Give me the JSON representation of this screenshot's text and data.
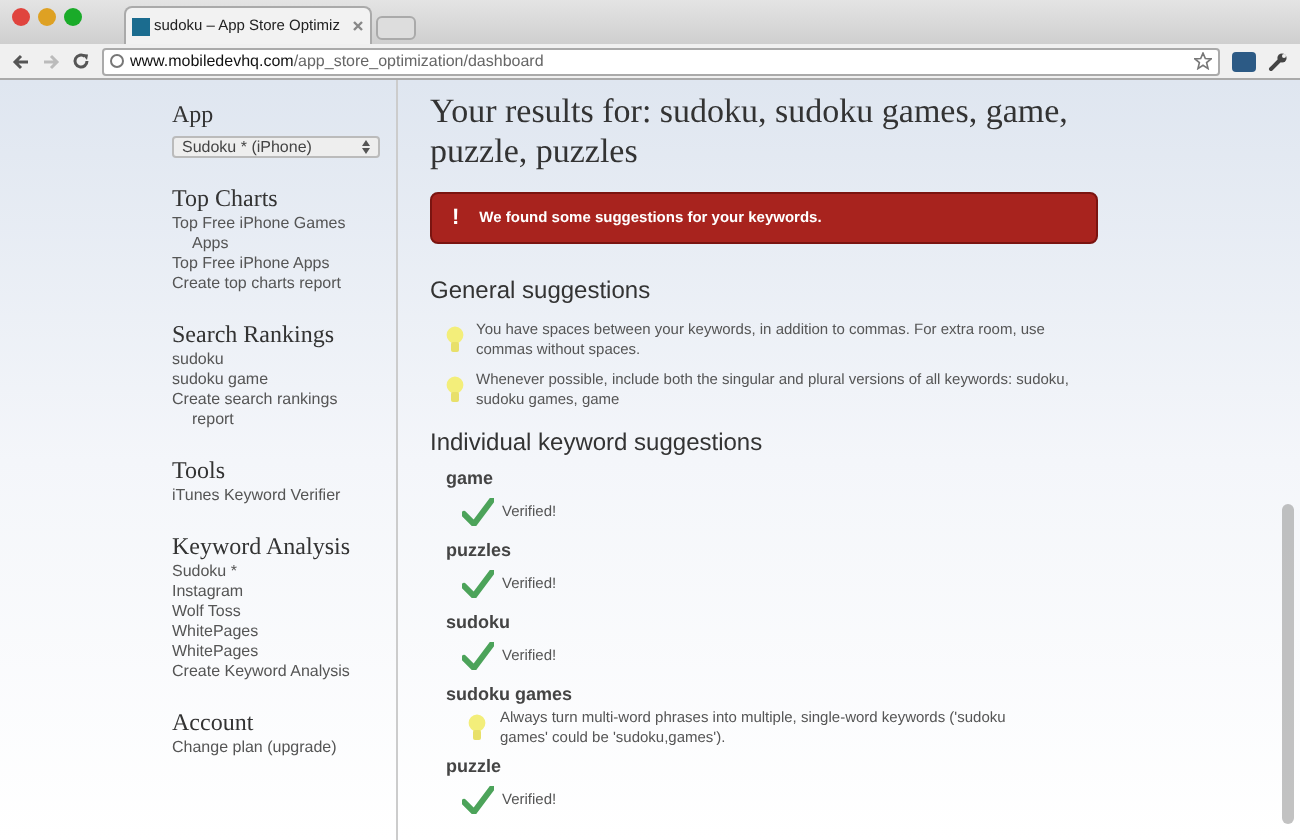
{
  "browser": {
    "tab_title": "sudoku – App Store Optimiz",
    "url_host": "www.mobiledevhq.com",
    "url_path": "/app_store_optimization/dashboard"
  },
  "sidebar": {
    "app_label": "App",
    "app_select": "Sudoku * (iPhone)",
    "sections": [
      {
        "title": "Top Charts",
        "items": [
          "Top Free iPhone Games Apps",
          "Top Free iPhone Apps",
          "Create top charts report"
        ]
      },
      {
        "title": "Search Rankings",
        "items": [
          "sudoku",
          "sudoku game",
          "Create search rankings report"
        ]
      },
      {
        "title": "Tools",
        "items": [
          "iTunes Keyword Verifier"
        ]
      },
      {
        "title": "Keyword Analysis",
        "items": [
          "Sudoku *",
          "Instagram",
          "Wolf Toss",
          "WhitePages",
          "WhitePages",
          "Create Keyword Analysis"
        ]
      },
      {
        "title": "Account",
        "items": [
          "Change plan (upgrade)"
        ]
      }
    ]
  },
  "main": {
    "title": "Your results for: sudoku, sudoku games, game, puzzle, puzzles",
    "alert": {
      "icon": "!",
      "text": "We found some suggestions for your keywords."
    },
    "general_heading": "General suggestions",
    "general": [
      "You have spaces between your keywords, in addition to commas. For extra room, use commas without spaces.",
      "Whenever possible, include both the singular and plural versions of all keywords: sudoku, sudoku games, game"
    ],
    "individual_heading": "Individual keyword suggestions",
    "keywords": [
      {
        "keyword": "game",
        "kind": "verified",
        "message": "Verified!"
      },
      {
        "keyword": "puzzles",
        "kind": "verified",
        "message": "Verified!"
      },
      {
        "keyword": "sudoku",
        "kind": "verified",
        "message": "Verified!"
      },
      {
        "keyword": "sudoku games",
        "kind": "tip",
        "message": "Always turn multi-word phrases into multiple, single-word keywords ('sudoku games' could be 'sudoku,games')."
      },
      {
        "keyword": "puzzle",
        "kind": "verified",
        "message": "Verified!"
      }
    ]
  }
}
